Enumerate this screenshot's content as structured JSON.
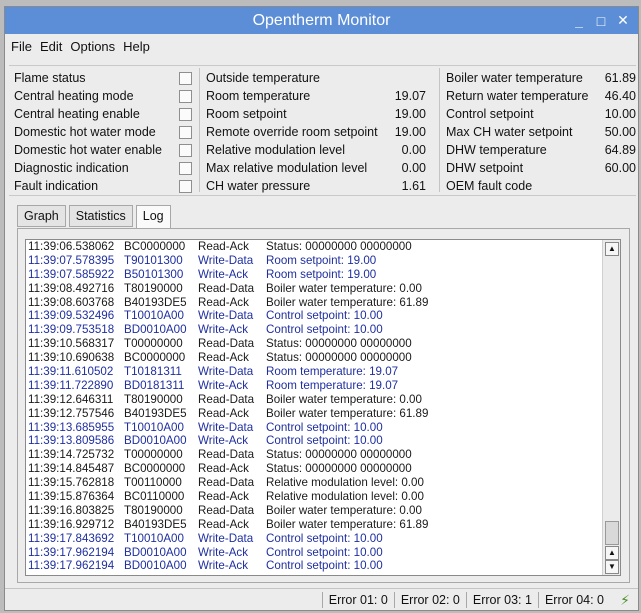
{
  "window": {
    "title": "Opentherm Monitor"
  },
  "titlebar": {
    "min": "_",
    "max": "□",
    "close": "✕"
  },
  "menu": [
    "File",
    "Edit",
    "Options",
    "Help"
  ],
  "status_flags": [
    "Flame status",
    "Central heating mode",
    "Central heating enable",
    "Domestic hot water mode",
    "Domestic hot water enable",
    "Diagnostic indication",
    "Fault indication"
  ],
  "room_values": [
    {
      "label": "Outside temperature",
      "value": ""
    },
    {
      "label": "Room temperature",
      "value": "19.07"
    },
    {
      "label": "Room setpoint",
      "value": "19.00"
    },
    {
      "label": "Remote override room setpoint",
      "value": "19.00"
    },
    {
      "label": "Relative modulation level",
      "value": "0.00"
    },
    {
      "label": "Max relative modulation level",
      "value": "0.00"
    },
    {
      "label": "CH water pressure",
      "value": "1.61"
    }
  ],
  "boiler_values": [
    {
      "label": "Boiler water temperature",
      "value": "61.89"
    },
    {
      "label": "Return water temperature",
      "value": "46.40"
    },
    {
      "label": "Control setpoint",
      "value": "10.00"
    },
    {
      "label": "Max CH water setpoint",
      "value": "50.00"
    },
    {
      "label": "DHW temperature",
      "value": "64.89"
    },
    {
      "label": "DHW setpoint",
      "value": "60.00"
    },
    {
      "label": "OEM fault code",
      "value": ""
    }
  ],
  "tabs": [
    "Graph",
    "Statistics",
    "Log"
  ],
  "log": [
    {
      "time": "11:39:06.538062",
      "hex": "BC0000000",
      "kind": "Read-Ack",
      "msg": "Status: 00000000 00000000",
      "dir": "read"
    },
    {
      "time": "11:39:07.578395",
      "hex": "T90101300",
      "kind": "Write-Data",
      "msg": "Room setpoint: 19.00",
      "dir": "write"
    },
    {
      "time": "11:39:07.585922",
      "hex": "B50101300",
      "kind": "Write-Ack",
      "msg": "Room setpoint: 19.00",
      "dir": "write"
    },
    {
      "time": "11:39:08.492716",
      "hex": "T80190000",
      "kind": "Read-Data",
      "msg": "Boiler water temperature: 0.00",
      "dir": "read"
    },
    {
      "time": "11:39:08.603768",
      "hex": "B40193DE5",
      "kind": "Read-Ack",
      "msg": "Boiler water temperature: 61.89",
      "dir": "read"
    },
    {
      "time": "11:39:09.532496",
      "hex": "T10010A00",
      "kind": "Write-Data",
      "msg": "Control setpoint: 10.00",
      "dir": "write"
    },
    {
      "time": "11:39:09.753518",
      "hex": "BD0010A00",
      "kind": "Write-Ack",
      "msg": "Control setpoint: 10.00",
      "dir": "write"
    },
    {
      "time": "11:39:10.568317",
      "hex": "T00000000",
      "kind": "Read-Data",
      "msg": "Status: 00000000 00000000",
      "dir": "read"
    },
    {
      "time": "11:39:10.690638",
      "hex": "BC0000000",
      "kind": "Read-Ack",
      "msg": "Status: 00000000 00000000",
      "dir": "read"
    },
    {
      "time": "11:39:11.610502",
      "hex": "T10181311",
      "kind": "Write-Data",
      "msg": "Room temperature: 19.07",
      "dir": "write"
    },
    {
      "time": "11:39:11.722890",
      "hex": "BD0181311",
      "kind": "Write-Ack",
      "msg": "Room temperature: 19.07",
      "dir": "write"
    },
    {
      "time": "11:39:12.646311",
      "hex": "T80190000",
      "kind": "Read-Data",
      "msg": "Boiler water temperature: 0.00",
      "dir": "read"
    },
    {
      "time": "11:39:12.757546",
      "hex": "B40193DE5",
      "kind": "Read-Ack",
      "msg": "Boiler water temperature: 61.89",
      "dir": "read"
    },
    {
      "time": "11:39:13.685955",
      "hex": "T10010A00",
      "kind": "Write-Data",
      "msg": "Control setpoint: 10.00",
      "dir": "write"
    },
    {
      "time": "11:39:13.809586",
      "hex": "BD0010A00",
      "kind": "Write-Ack",
      "msg": "Control setpoint: 10.00",
      "dir": "write"
    },
    {
      "time": "11:39:14.725732",
      "hex": "T00000000",
      "kind": "Read-Data",
      "msg": "Status: 00000000 00000000",
      "dir": "read"
    },
    {
      "time": "11:39:14.845487",
      "hex": "BC0000000",
      "kind": "Read-Ack",
      "msg": "Status: 00000000 00000000",
      "dir": "read"
    },
    {
      "time": "11:39:15.762818",
      "hex": "T00110000",
      "kind": "Read-Data",
      "msg": "Relative modulation level: 0.00",
      "dir": "read"
    },
    {
      "time": "11:39:15.876364",
      "hex": "BC0110000",
      "kind": "Read-Ack",
      "msg": "Relative modulation level: 0.00",
      "dir": "read"
    },
    {
      "time": "11:39:16.803825",
      "hex": "T80190000",
      "kind": "Read-Data",
      "msg": "Boiler water temperature: 0.00",
      "dir": "read"
    },
    {
      "time": "11:39:16.929712",
      "hex": "B40193DE5",
      "kind": "Read-Ack",
      "msg": "Boiler water temperature: 61.89",
      "dir": "read"
    },
    {
      "time": "11:39:17.843692",
      "hex": "T10010A00",
      "kind": "Write-Data",
      "msg": "Control setpoint: 10.00",
      "dir": "write"
    },
    {
      "time": "11:39:17.962194",
      "hex": "BD0010A00",
      "kind": "Write-Ack",
      "msg": "Control setpoint: 10.00",
      "dir": "write"
    },
    {
      "time": "11:39:17.962194",
      "hex": "BD0010A00",
      "kind": "Write-Ack",
      "msg": "Control setpoint: 10.00",
      "dir": "write"
    }
  ],
  "errors": [
    "Error 01:  0",
    "Error 02:  0",
    "Error 03:  1",
    "Error 04:  0"
  ],
  "colors": {
    "titlebar": "#5b8ed6",
    "log_write": "#1f2fa0",
    "log_read": "#1a1a1a"
  },
  "icons": {
    "status_plug": "plug-icon"
  }
}
